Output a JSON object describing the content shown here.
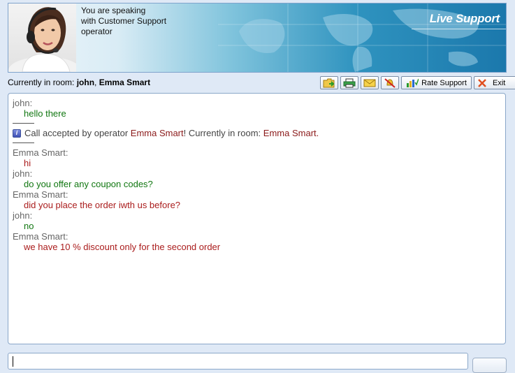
{
  "header": {
    "line1": "You are speaking",
    "line2": "with Customer Support",
    "line3": "operator",
    "brand": "Live Support"
  },
  "room": {
    "prefix": "Currently in room:",
    "user": "john",
    "sep": ",",
    "operator": "Emma Smart"
  },
  "toolbar": {
    "rate_label": "Rate Support",
    "exit_label": "Exit"
  },
  "chat": {
    "m1_name": "john:",
    "m1_text": "hello there",
    "sys_prefix": "Call accepted by operator",
    "sys_operator": "Emma Smart",
    "sys_middle": "! Currently in room:",
    "sys_room": "Emma Smart",
    "sys_end": ".",
    "m2_name": "Emma Smart:",
    "m2_text": "hi",
    "m3_name": "john:",
    "m3_text": "do you offer any coupon codes?",
    "m4_name": "Emma Smart:",
    "m4_text": "did you place the order iwth us before?",
    "m5_name": "john:",
    "m5_text": "no",
    "m6_name": "Emma Smart:",
    "m6_text": "we have 10 % discount only for the second order"
  },
  "colors": {
    "user_text": "#117711",
    "operator_text": "#aa1c1c",
    "header_blue": "#1b78ac"
  }
}
